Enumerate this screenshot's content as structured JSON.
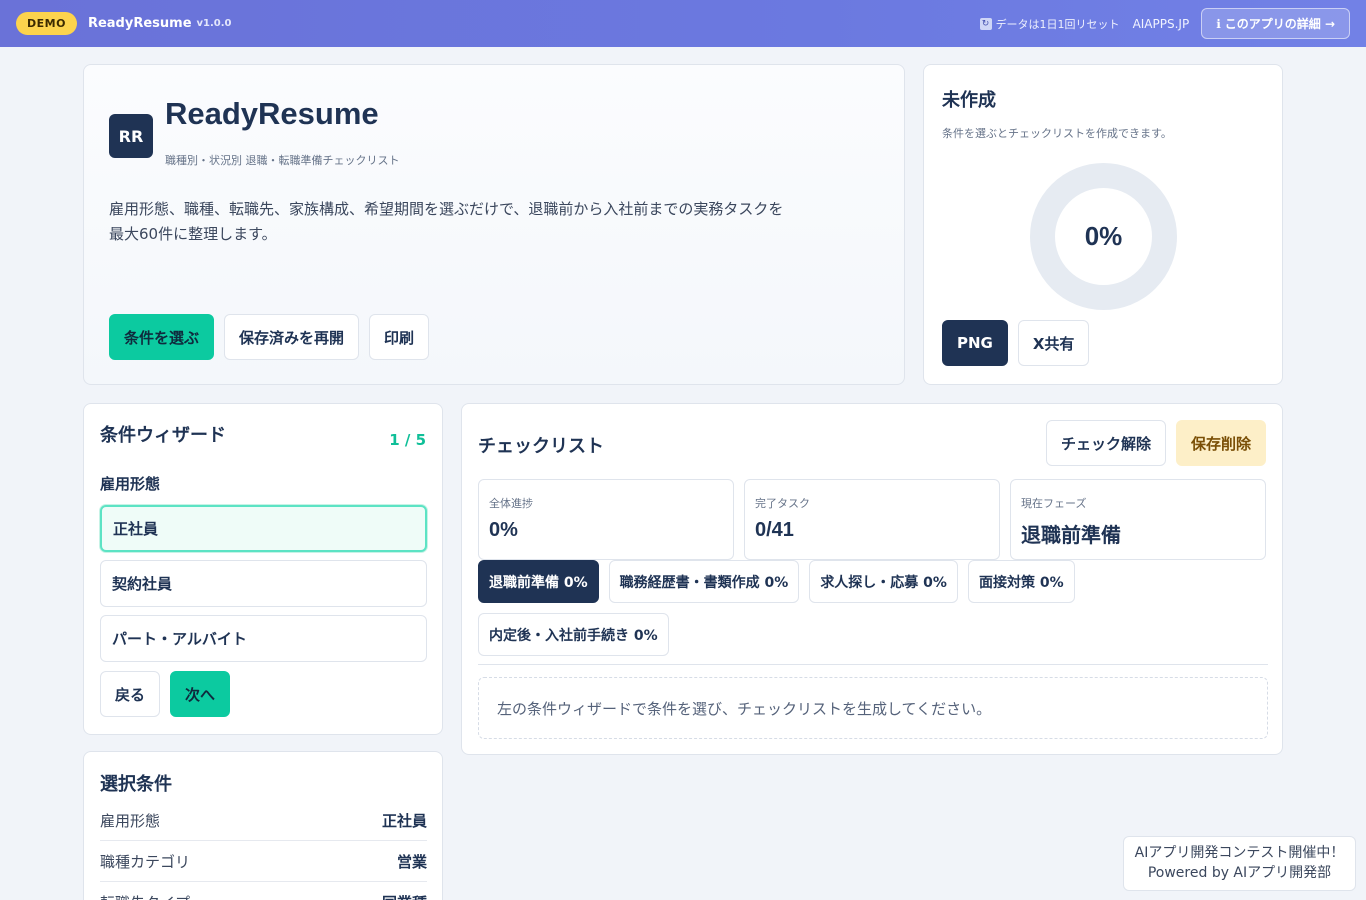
{
  "topbar": {
    "badge": "DEMO",
    "app_name": "ReadyResume",
    "version": "v1.0.0",
    "reset_note": "データは1日1回リセット",
    "site": "AIAPPS.JP",
    "details_button": "このアプリの詳細 →"
  },
  "hero": {
    "logo": "RR",
    "title": "ReadyResume",
    "subtitle": "職種別・状況別 退職・転職準備チェックリスト",
    "description_line1": "雇用形態、職種、転職先、家族構成、希望期間を選ぶだけで、退職前から入社前までの実務タスクを",
    "description_line2": "最大60件に整理します。",
    "actions": {
      "select": "条件を選ぶ",
      "resume": "保存済みを再開",
      "print": "印刷"
    }
  },
  "progress": {
    "title": "未作成",
    "subtitle": "条件を選ぶとチェックリストを作成できます。",
    "percent_text": "0%",
    "percent_value": 0,
    "png_button": "PNG",
    "share_button": "X共有"
  },
  "wizard": {
    "title": "条件ウィザード",
    "step": "1 / 5",
    "question": "雇用形態",
    "options": [
      "正社員",
      "契約社員",
      "パート・アルバイト"
    ],
    "selected_index": 0,
    "back": "戻る",
    "next": "次へ"
  },
  "selected_conditions": {
    "title": "選択条件",
    "rows": [
      {
        "key": "雇用形態",
        "value": "正社員"
      },
      {
        "key": "職種カテゴリ",
        "value": "営業"
      },
      {
        "key": "転職先タイプ",
        "value": "同業種"
      }
    ]
  },
  "checklist": {
    "title": "チェックリスト",
    "uncheck_button": "チェック解除",
    "delete_button": "保存削除",
    "stats": [
      {
        "label": "全体進捗",
        "value": "0%"
      },
      {
        "label": "完了タスク",
        "value": "0/41"
      },
      {
        "label": "現在フェーズ",
        "value": "退職前準備"
      }
    ],
    "phases": [
      "退職前準備 0%",
      "職務経歴書・書類作成 0%",
      "求人探し・応募 0%",
      "面接対策 0%",
      "内定後・入社前手続き 0%"
    ],
    "active_phase": 0,
    "empty_message": "左の条件ウィザードで条件を選び、チェックリストを生成してください。"
  },
  "contest": {
    "line1": "AIアプリ開発コンテスト開催中！",
    "line2": "Powered by AIアプリ開発部"
  },
  "colors": {
    "accent": "#0ccaa0",
    "primary_dark": "#1f3354",
    "warning_bg": "#fdefc8",
    "ring_track": "#e6ebf2"
  }
}
